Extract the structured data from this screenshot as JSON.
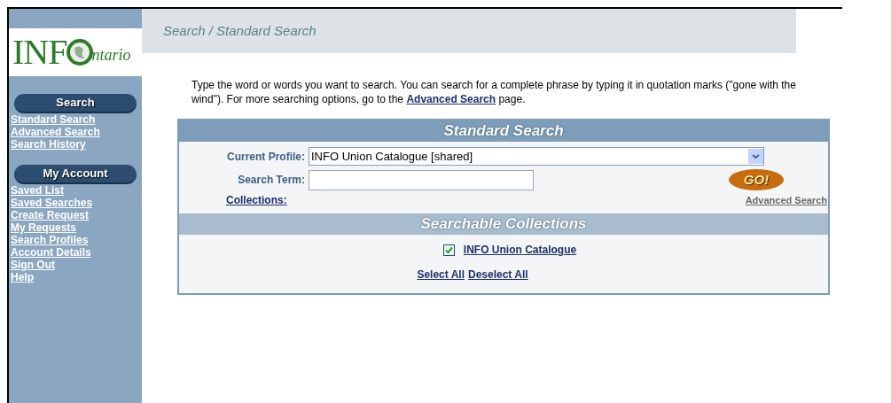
{
  "logo": {
    "part_1": "INF",
    "part_2": "ntario"
  },
  "sidebar": [
    {
      "title": "Search",
      "links": [
        "Standard Search",
        "Advanced Search",
        "Search History"
      ]
    },
    {
      "title": "My Account",
      "links": [
        "Saved List",
        "Saved Searches",
        "Create Request",
        "My Requests",
        "Search Profiles",
        "Account Details",
        "Sign Out",
        "Help"
      ]
    }
  ],
  "breadcrumb": "Search / Standard Search",
  "intro": {
    "before": "Type the word or words you want to search. You can search for a complete phrase by typing it in quotation marks (\"gone with the wind\"). For more searching options, go to the ",
    "link": "Advanced Search",
    "after": " page."
  },
  "standard_search": {
    "title": "Standard Search",
    "profile_label": "Current Profile:",
    "profile_value": "INFO Union Catalogue [shared]",
    "term_label": "Search Term:",
    "go": "GO!",
    "collections_link": "Collections:",
    "advanced_link": "Advanced Search"
  },
  "collections": {
    "title": "Searchable Collections",
    "items": [
      {
        "label": "INFO Union Catalogue",
        "checked": true
      }
    ],
    "select_all": "Select All",
    "deselect_all": "Deselect All"
  }
}
